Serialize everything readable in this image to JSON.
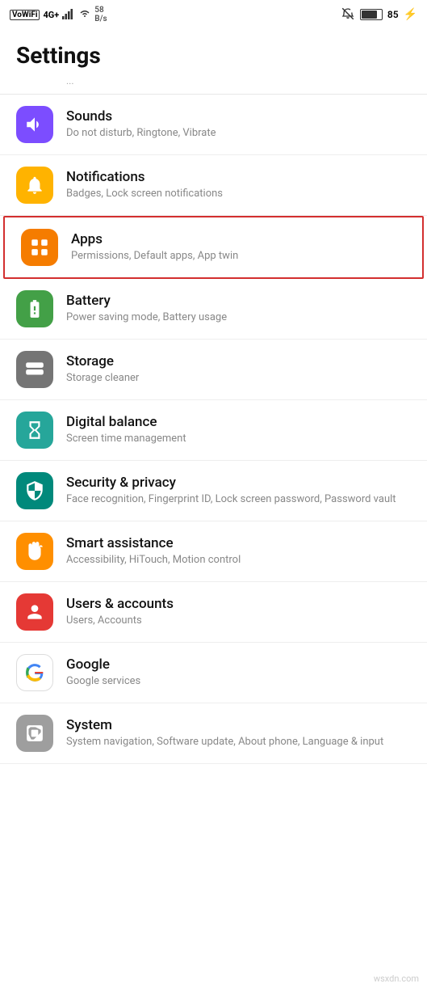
{
  "statusBar": {
    "left": {
      "wovifi": "VoWiFi",
      "network": "4G+",
      "speed": "58 B/s"
    },
    "right": {
      "battery": "85"
    }
  },
  "pageTitle": "Settings",
  "partialText": "...",
  "items": [
    {
      "id": "sounds",
      "title": "Sounds",
      "subtitle": "Do not disturb, Ringtone, Vibrate",
      "iconColor": "purple",
      "iconType": "sound"
    },
    {
      "id": "notifications",
      "title": "Notifications",
      "subtitle": "Badges, Lock screen notifications",
      "iconColor": "orange-yellow",
      "iconType": "bell"
    },
    {
      "id": "apps",
      "title": "Apps",
      "subtitle": "Permissions, Default apps, App twin",
      "iconColor": "orange",
      "iconType": "apps",
      "highlighted": true
    },
    {
      "id": "battery",
      "title": "Battery",
      "subtitle": "Power saving mode, Battery usage",
      "iconColor": "green",
      "iconType": "battery"
    },
    {
      "id": "storage",
      "title": "Storage",
      "subtitle": "Storage cleaner",
      "iconColor": "gray",
      "iconType": "storage"
    },
    {
      "id": "digital-balance",
      "title": "Digital balance",
      "subtitle": "Screen time management",
      "iconColor": "teal",
      "iconType": "hourglass"
    },
    {
      "id": "security-privacy",
      "title": "Security & privacy",
      "subtitle": "Face recognition, Fingerprint ID, Lock screen password, Password vault",
      "iconColor": "teal-dark",
      "iconType": "shield"
    },
    {
      "id": "smart-assistance",
      "title": "Smart assistance",
      "subtitle": "Accessibility, HiTouch, Motion control",
      "iconColor": "orange-hand",
      "iconType": "hand"
    },
    {
      "id": "users-accounts",
      "title": "Users & accounts",
      "subtitle": "Users, Accounts",
      "iconColor": "red",
      "iconType": "user"
    },
    {
      "id": "google",
      "title": "Google",
      "subtitle": "Google services",
      "iconColor": "white-google",
      "iconType": "google"
    },
    {
      "id": "system",
      "title": "System",
      "subtitle": "System navigation, Software update, About phone, Language & input",
      "iconColor": "gray-system",
      "iconType": "system"
    }
  ],
  "watermark": "wsxdn.com"
}
